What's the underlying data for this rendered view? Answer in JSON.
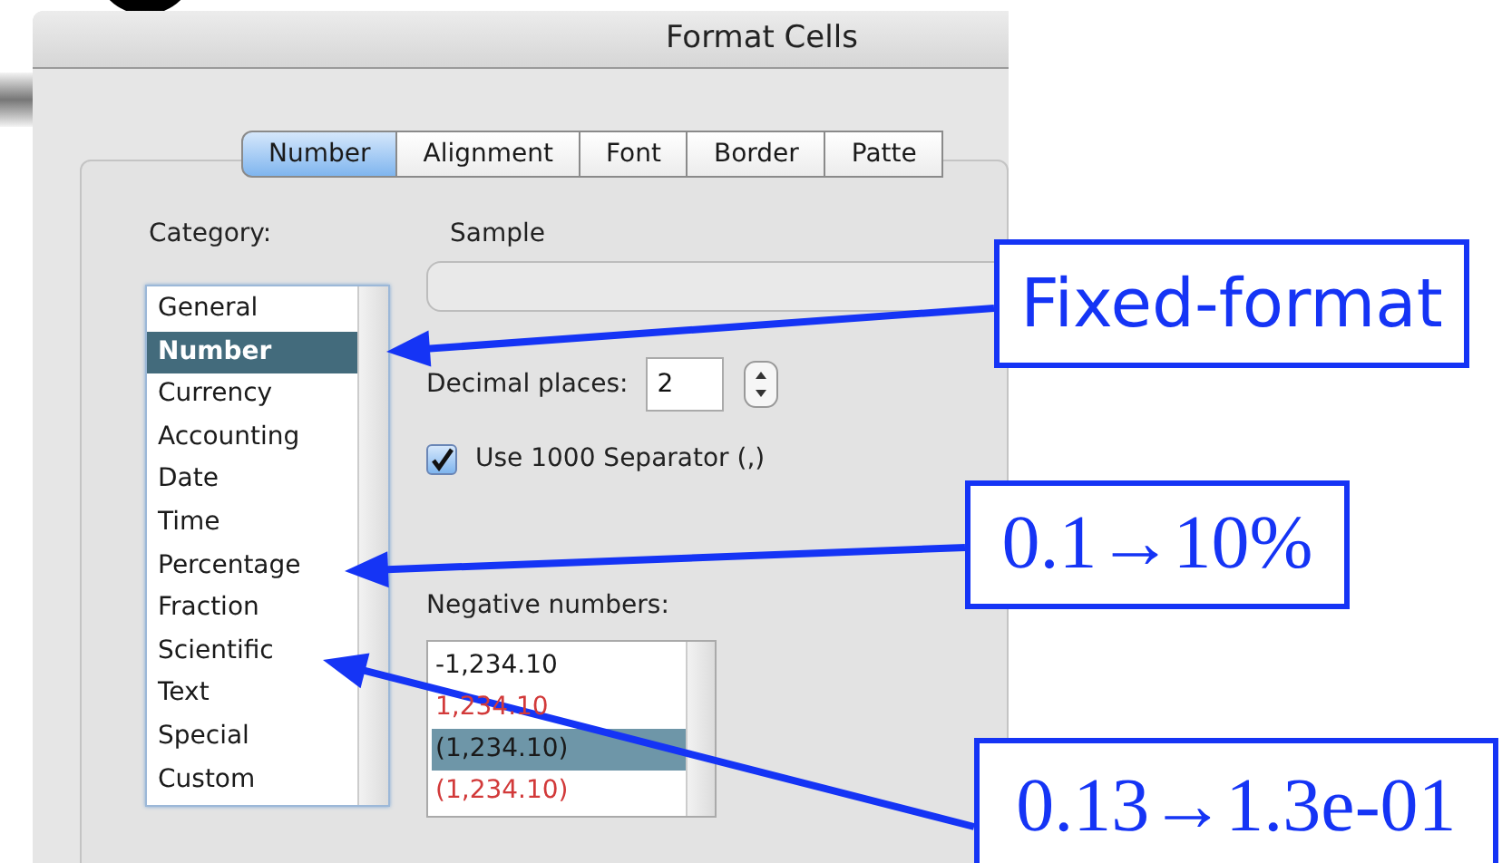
{
  "dialog": {
    "title": "Format Cells",
    "tabs": [
      {
        "label": "Number",
        "selected": true
      },
      {
        "label": "Alignment",
        "selected": false
      },
      {
        "label": "Font",
        "selected": false
      },
      {
        "label": "Border",
        "selected": false
      },
      {
        "label": "Patte",
        "selected": false
      }
    ],
    "category": {
      "label": "Category:",
      "items": [
        {
          "label": "General",
          "selected": false
        },
        {
          "label": "Number",
          "selected": true
        },
        {
          "label": "Currency",
          "selected": false
        },
        {
          "label": "Accounting",
          "selected": false
        },
        {
          "label": "Date",
          "selected": false
        },
        {
          "label": "Time",
          "selected": false
        },
        {
          "label": "Percentage",
          "selected": false
        },
        {
          "label": "Fraction",
          "selected": false
        },
        {
          "label": "Scientific",
          "selected": false
        },
        {
          "label": "Text",
          "selected": false
        },
        {
          "label": "Special",
          "selected": false
        },
        {
          "label": "Custom",
          "selected": false
        }
      ]
    },
    "sample": {
      "label": "Sample"
    },
    "decimal_places": {
      "label": "Decimal places:",
      "value": "2"
    },
    "separator": {
      "label": "Use 1000 Separator (,)",
      "checked": true
    },
    "negative_numbers": {
      "label": "Negative numbers:",
      "items": [
        {
          "label": "-1,234.10",
          "color": "#1a1a1a",
          "selected": false
        },
        {
          "label": "1,234.10",
          "color": "#d23a3a",
          "selected": false
        },
        {
          "label": "(1,234.10)",
          "color": "#1a1a1a",
          "selected": true
        },
        {
          "label": "(1,234.10)",
          "color": "#d23a3a",
          "selected": false
        }
      ]
    }
  },
  "annotations": [
    {
      "text": "Fixed-format",
      "kind": "sans"
    },
    {
      "text": "0.1→10%",
      "kind": "serif"
    },
    {
      "text": "0.13→1.3e-01",
      "kind": "serif"
    }
  ]
}
